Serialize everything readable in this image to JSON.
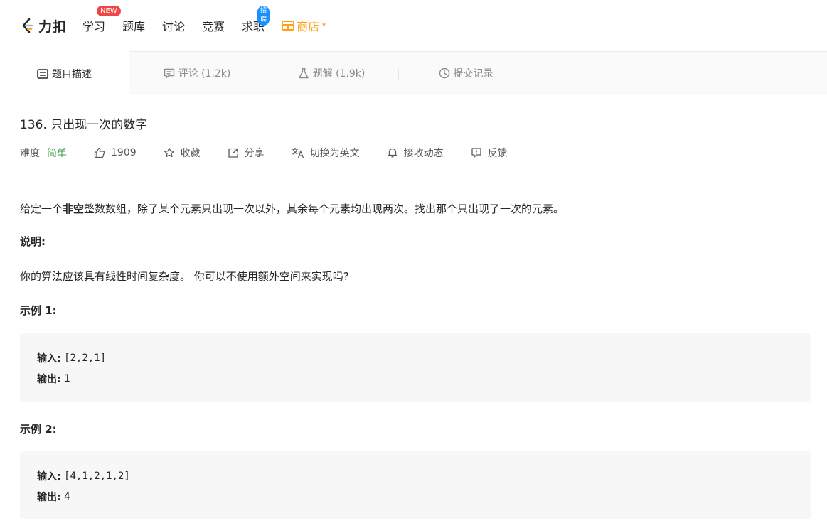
{
  "nav": {
    "logo_text": "力扣",
    "items": [
      {
        "label": "学习",
        "badge": "NEW"
      },
      {
        "label": "题库"
      },
      {
        "label": "讨论"
      },
      {
        "label": "竞赛"
      },
      {
        "label": "求职",
        "badge": "招聘"
      }
    ],
    "store_label": "商店",
    "store_caret": "▾",
    "accent": "#ffa116"
  },
  "tabs": [
    {
      "label": "题目描述",
      "icon": "description-icon",
      "active": true
    },
    {
      "label": "评论 (1.2k)",
      "icon": "comment-icon"
    },
    {
      "label": "题解 (1.9k)",
      "icon": "flask-icon"
    },
    {
      "label": "提交记录",
      "icon": "clock-icon"
    }
  ],
  "problem": {
    "title": "136. 只出现一次的数字",
    "difficulty_label": "难度",
    "difficulty": "简单",
    "difficulty_color": "#43a047",
    "likes": "1909",
    "favorite_label": "收藏",
    "share_label": "分享",
    "translate_label": "切换为英文",
    "subscribe_label": "接收动态",
    "feedback_label": "反馈"
  },
  "description": {
    "intro_pre": "给定一个",
    "intro_bold": "非空",
    "intro_post": "整数数组，除了某个元素只出现一次以外，其余每个元素均出现两次。找出那个只出现了一次的元素。",
    "note_heading": "说明:",
    "note_text": "你的算法应该具有线性时间复杂度。 你可以不使用额外空间来实现吗?",
    "examples": [
      {
        "heading": "示例 1:",
        "input_label": "输入:",
        "input": "[2,2,1]",
        "output_label": "输出:",
        "output": "1"
      },
      {
        "heading": "示例 2:",
        "input_label": "输入:",
        "input": "[4,1,2,1,2]",
        "output_label": "输出:",
        "output": "4"
      }
    ]
  }
}
